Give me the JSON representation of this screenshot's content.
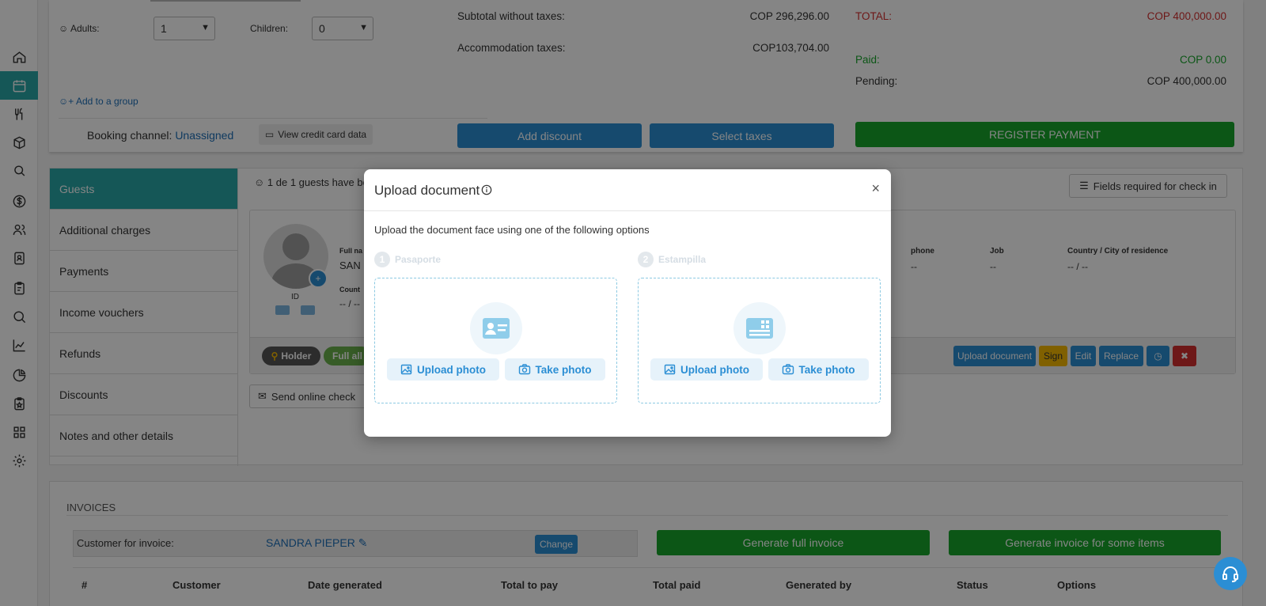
{
  "booking": {
    "adults_label": "Adults:",
    "adults_value": "1",
    "children_label": "Children:",
    "children_value": "0",
    "add_group_label": "Add to a group",
    "channel_label": "Booking channel:",
    "channel_value": "Unassigned",
    "view_card_label": "View credit card data"
  },
  "totals": {
    "subtotal_label": "Subtotal without taxes:",
    "subtotal_value": "COP 296,296.00",
    "acc_tax_label": "Accommodation taxes:",
    "acc_tax_value": "COP103,704.00",
    "total_label": "TOTAL:",
    "total_value": "COP 400,000.00",
    "paid_label": "Paid:",
    "paid_value": "COP 0.00",
    "pending_label": "Pending:",
    "pending_value": "COP 400,000.00",
    "add_discount": "Add discount",
    "select_taxes": "Select taxes",
    "register_payment": "REGISTER PAYMENT"
  },
  "tabs": [
    "Guests",
    "Additional charges",
    "Payments",
    "Income vouchers",
    "Refunds",
    "Discounts",
    "Notes and other details"
  ],
  "guests": {
    "summary": "1 de 1 guests have be",
    "fields_required": "Fields required for check in",
    "id_label": "ID",
    "fullname_label": "Full na",
    "fullname_value": "SAN",
    "country_label": "Count",
    "country_value": "-- / --",
    "phone_label": "phone",
    "phone_value": "--",
    "job_label": "Job",
    "job_value": "--",
    "residence_label": "Country / City of residence",
    "residence_value": "-- / --",
    "holder_label": "Holder",
    "full_label": "Full all",
    "upload_document": "Upload document",
    "sign": "Sign",
    "edit": "Edit",
    "replace": "Replace",
    "send_online": "Send online check"
  },
  "invoices": {
    "title": "INVOICES",
    "customer_label": "Customer for invoice:",
    "customer_name": "SANDRA PIEPER",
    "change": "Change",
    "generate_full": "Generate full invoice",
    "generate_some": "Generate invoice for some items",
    "columns": [
      "#",
      "Customer",
      "Date generated",
      "Total to pay",
      "Total paid",
      "Generated by",
      "Status",
      "Options"
    ]
  },
  "modal": {
    "title": "Upload document",
    "description": "Upload the document face using one of the following options",
    "steps": [
      {
        "num": "1",
        "label": "Pasaporte",
        "upload": "Upload photo",
        "take": "Take photo"
      },
      {
        "num": "2",
        "label": "Estampilla",
        "upload": "Upload photo",
        "take": "Take photo"
      }
    ],
    "close": "×"
  },
  "colors": {
    "teal": "#2aa8a8",
    "blue": "#2b8ed4",
    "green": "#17a52b",
    "red": "#d32f2f",
    "yellow": "#f5b800"
  }
}
